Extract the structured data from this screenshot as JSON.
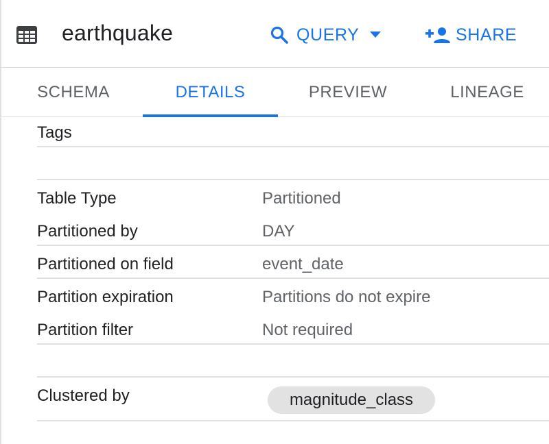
{
  "header": {
    "title": "earthquake",
    "query_label": "QUERY",
    "share_label": "SHARE",
    "accent": "#1a73e8"
  },
  "tabs": [
    {
      "label": "SCHEMA",
      "active": false
    },
    {
      "label": "DETAILS",
      "active": true
    },
    {
      "label": "PREVIEW",
      "active": false
    },
    {
      "label": "LINEAGE",
      "active": false
    }
  ],
  "details": {
    "tags_label": "Tags",
    "rows": [
      {
        "label": "Table Type",
        "value": "Partitioned"
      },
      {
        "label": "Partitioned by",
        "value": "DAY"
      },
      {
        "label": "Partitioned on field",
        "value": "event_date"
      },
      {
        "label": "Partition expiration",
        "value": "Partitions do not expire"
      },
      {
        "label": "Partition filter",
        "value": "Not required"
      }
    ],
    "clustered": {
      "label": "Clustered by",
      "chip": "magnitude_class"
    }
  },
  "icons": {
    "table": "table-icon",
    "search": "search-icon",
    "caret": "caret-down-icon",
    "share": "person-add-icon"
  }
}
